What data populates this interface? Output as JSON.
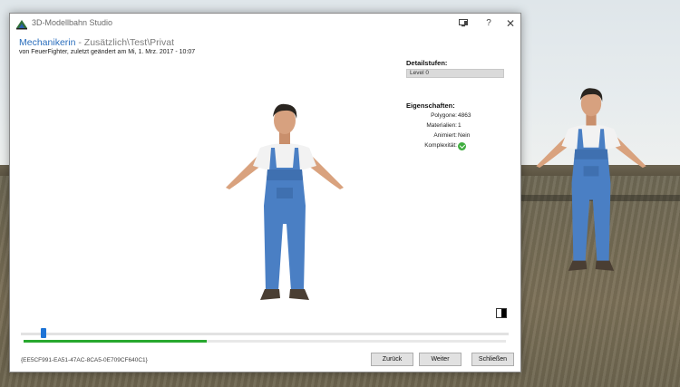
{
  "window": {
    "app_title": "3D-Modellbahn Studio",
    "app_icon": "app-logo-icon",
    "controls": {
      "monitor": "monitor-icon",
      "help": "?",
      "close": "✕"
    }
  },
  "model": {
    "name": "Mechanikerin",
    "path": " - Zusätzlich\\Test\\Privat",
    "byline": "von FeuerFighter, zuletzt geändert am Mi, 1. Mrz. 2017 - 10:07",
    "id": "{EE5CF991-EA51-47AC-8CA5-0E709CF640C1}"
  },
  "details": {
    "title": "Detailstufen:",
    "selected_level": "Level 0"
  },
  "properties": {
    "title": "Eigenschaften:",
    "polygons_label": "Polygone:",
    "polygons_value": "4863",
    "materials_label": "Materialien:",
    "materials_value": "1",
    "animated_label": "Animiert:",
    "animated_value": "Nein",
    "complexity_label": "Komplexität:",
    "complexity_status": "ok-check-icon"
  },
  "viewer": {
    "zoom_slider_fraction": 0.04,
    "load_progress_fraction": 0.38
  },
  "buttons": {
    "back": "Zurück",
    "next": "Weiter",
    "close": "Schließen"
  },
  "colors": {
    "accent": "#2a6ebd",
    "slider": "#1e74d6",
    "progress": "#28a82e",
    "overalls": "#4a7fc4"
  }
}
